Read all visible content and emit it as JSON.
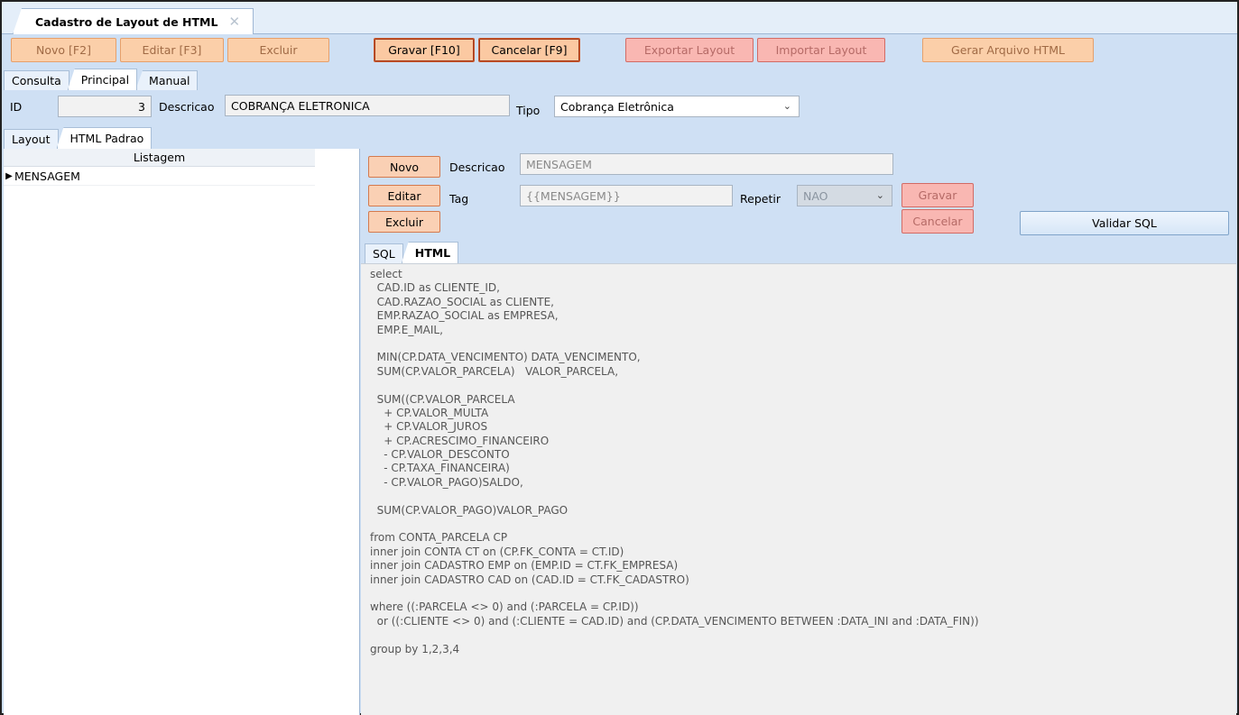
{
  "window": {
    "tab_title": "Cadastro de Layout de HTML",
    "close_symbol": "✕"
  },
  "toolbar": {
    "novo": "Novo [F2]",
    "editar": "Editar [F3]",
    "excluir": "Excluir",
    "gravar": "Gravar [F10]",
    "cancelar": "Cancelar [F9]",
    "exportar": "Exportar Layout",
    "importar": "Importar Layout",
    "gerar": "Gerar Arquivo HTML"
  },
  "main_tabs": {
    "consulta": "Consulta",
    "principal": "Principal",
    "manual": "Manual"
  },
  "header": {
    "id_label": "ID",
    "id_value": "3",
    "descricao_label": "Descricao",
    "descricao_value": "COBRANÇA ELETRONICA",
    "tipo_label": "Tipo",
    "tipo_value": "Cobrança Eletrônica"
  },
  "sub_tabs": {
    "layout": "Layout",
    "html_padrao": "HTML Padrao"
  },
  "listagem": {
    "header": "Listagem",
    "items": [
      "MENSAGEM"
    ]
  },
  "detail": {
    "novo": "Novo",
    "editar": "Editar",
    "excluir": "Excluir",
    "descricao_label": "Descricao",
    "descricao_value": "MENSAGEM",
    "tag_label": "Tag",
    "tag_value": "{{MENSAGEM}}",
    "repetir_label": "Repetir",
    "repetir_value": "NAO",
    "gravar": "Gravar",
    "cancelar": "Cancelar",
    "validar_sql": "Validar SQL"
  },
  "editor_tabs": {
    "sql": "SQL",
    "html": "HTML"
  },
  "sql_lines": [
    "select",
    "  CAD.ID as CLIENTE_ID,",
    "  CAD.RAZAO_SOCIAL as CLIENTE,",
    "  EMP.RAZAO_SOCIAL as EMPRESA,",
    "  EMP.E_MAIL,",
    "",
    "  MIN(CP.DATA_VENCIMENTO) DATA_VENCIMENTO,",
    "  SUM(CP.VALOR_PARCELA)   VALOR_PARCELA,",
    "",
    "  SUM((CP.VALOR_PARCELA",
    "    + CP.VALOR_MULTA",
    "    + CP.VALOR_JUROS",
    "    + CP.ACRESCIMO_FINANCEIRO",
    "    - CP.VALOR_DESCONTO",
    "    - CP.TAXA_FINANCEIRA)",
    "    - CP.VALOR_PAGO)SALDO,",
    "",
    "  SUM(CP.VALOR_PAGO)VALOR_PAGO",
    "",
    "from CONTA_PARCELA CP",
    "inner join CONTA CT on (CP.FK_CONTA = CT.ID)",
    "inner join CADASTRO EMP on (EMP.ID = CT.FK_EMPRESA)",
    "inner join CADASTRO CAD on (CAD.ID = CT.FK_CADASTRO)",
    "",
    "where ((:PARCELA <> 0) and (:PARCELA = CP.ID))",
    "  or ((:CLIENTE <> 0) and (:CLIENTE = CAD.ID) and (CP.DATA_VENCIMENTO BETWEEN :DATA_INI and :DATA_FIN))",
    "",
    "group by 1,2,3,4"
  ]
}
